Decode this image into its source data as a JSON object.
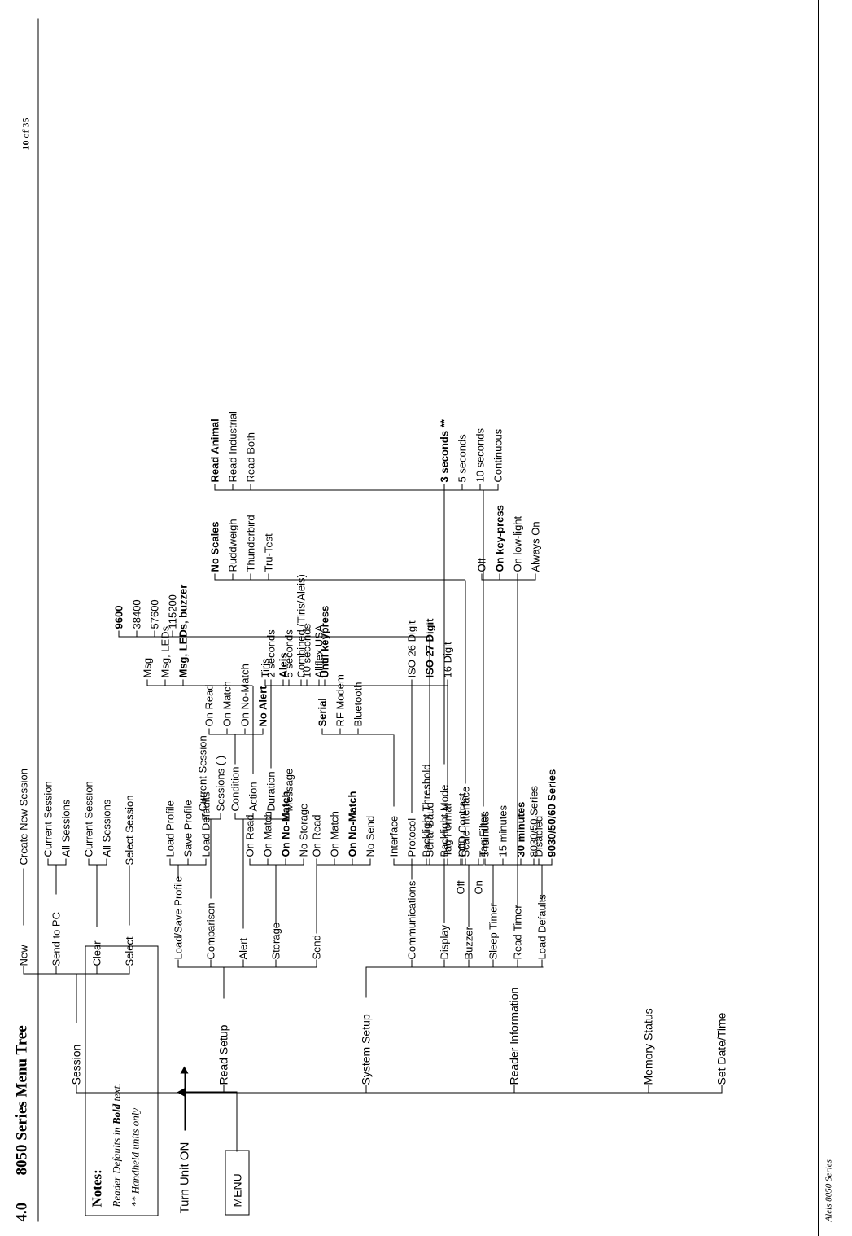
{
  "document": {
    "section_number": "4.0",
    "title": "8050 Series Menu Tree",
    "page_label": "10 of 35",
    "page_label_bold_part": "10",
    "footer": "Aleis 8050 Series"
  },
  "notes": {
    "heading": "Notes:",
    "line1": "Reader Defaults in Bold text.",
    "line1_plain": "Reader Defaults in ",
    "line1_bold": "Bold",
    "line1_tail": " text.",
    "line2": "** Handheld units only"
  },
  "entry": {
    "power_label": "Turn Unit ON",
    "menu_label": "MENU"
  },
  "tree": {
    "level1": [
      {
        "label": "Session"
      },
      {
        "label": "Read Setup"
      },
      {
        "label": "System Setup"
      },
      {
        "label": "Reader Information"
      },
      {
        "label": "Memory Status"
      },
      {
        "label": "Set Date/Time"
      }
    ],
    "session": {
      "items": [
        {
          "label": "New",
          "children": [
            "Create New Session"
          ]
        },
        {
          "label": "Send to PC",
          "children": [
            "Current Session",
            "All Sessions"
          ]
        },
        {
          "label": "Clear",
          "children": [
            "Current Session",
            "All Sessions"
          ]
        },
        {
          "label": "Select",
          "children": [
            "Select Session"
          ]
        }
      ]
    },
    "read_setup": {
      "items": [
        {
          "label": "Load/Save Profile",
          "children": [
            "Load Profile",
            "Save Profile",
            "Load Defaults"
          ]
        },
        {
          "label": "Comparison",
          "children": [
            "Current Session",
            "Sessions (  )"
          ]
        },
        {
          "label": "Alert",
          "children": [
            "Condition",
            "Action",
            "Duration",
            "Message"
          ]
        },
        {
          "label": "Storage",
          "children": [
            "On Read",
            "On Match",
            "On No-Match",
            "No Storage"
          ],
          "bold_index": 2
        },
        {
          "label": "Send",
          "children": [
            "On Read",
            "On Match",
            "On No-Match",
            "No Send"
          ],
          "bold_index": 2
        }
      ],
      "alert_condition": {
        "children": [
          "On Read",
          "On Match",
          "On No-Match",
          "No Alert"
        ],
        "bold_index": 3
      },
      "alert_action": {
        "children": [
          "Msg",
          "Msg, LEDs",
          "Msg, LEDs, buzzer"
        ],
        "bold_index": 2
      },
      "alert_duration": {
        "children": [
          "2 seconds",
          "5 seconds",
          "10 seconds",
          "Until keypress"
        ],
        "bold_index": 3
      }
    },
    "system_setup": {
      "items": [
        {
          "label": "Communications",
          "children": [
            "Interface",
            "Protocol",
            "Serial Baud",
            "Tag Format",
            "Scale Interface",
            "Tag Filter"
          ]
        },
        {
          "label": "Display",
          "children": [
            "Backlight Threshold",
            "Backlight Mode",
            "LCD Contrast"
          ]
        },
        {
          "label": "Buzzer",
          "children": [
            "Off",
            "On"
          ]
        },
        {
          "label": "Sleep Timer",
          "children": [
            "5 minutes",
            "15 minutes",
            "30 minutes",
            "Disabled"
          ],
          "bold_index": 2
        },
        {
          "label": "Read Timer",
          "children": [
            "Off",
            "On key-press",
            "On low-light",
            "Always On"
          ],
          "bold_index": 1
        },
        {
          "label": "Load Defaults",
          "children": [
            "8030/50 Series",
            "9030/50/60 Series"
          ],
          "bold_index": 1
        }
      ],
      "interface": {
        "children": [
          "Serial",
          "RF Modem",
          "Bluetooth"
        ],
        "bold_index": 0
      },
      "protocol": {
        "children": [
          "Tiris",
          "Aleis",
          "Combined (Tiris/Aleis)",
          "Allflex USA"
        ],
        "bold_index": 1
      },
      "serial_baud": {
        "children": [
          "9600",
          "38400",
          "57600",
          "115200"
        ],
        "bold_index": 0
      },
      "tag_format": {
        "children": [
          "ISO 26 Digit",
          "ISO 27 Digit",
          "16 Digit"
        ],
        "bold_index": 1
      },
      "scale_interface": {
        "children": [
          "No Scales",
          "Ruddweigh",
          "Thunderbird",
          "Tru-Test"
        ],
        "bold_index": 0
      },
      "tag_filter": {
        "children": [
          "Read Animal",
          "Read Industrial",
          "Read Both"
        ],
        "bold_index": 0
      },
      "backlight_mode": {
        "children": [
          "3 seconds **",
          "5 seconds",
          "10 seconds",
          "Continuous"
        ],
        "bold_index": 0
      }
    }
  }
}
